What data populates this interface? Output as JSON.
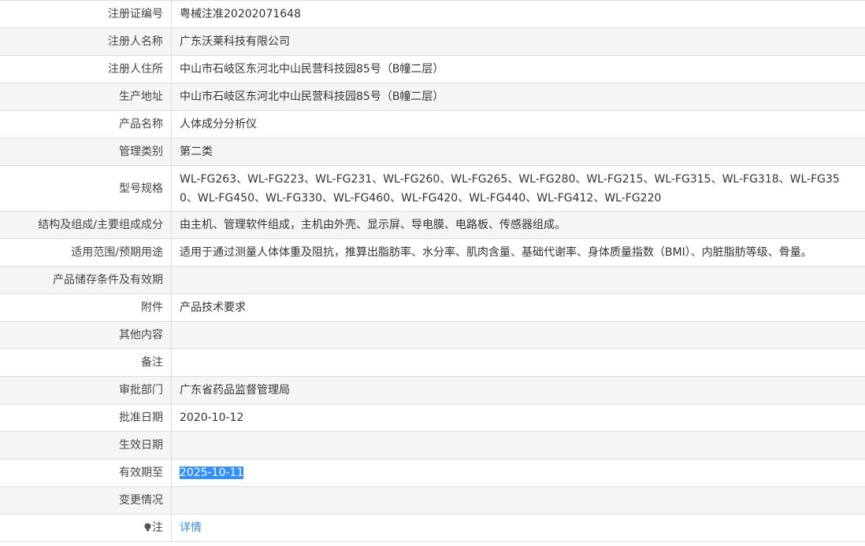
{
  "rows": [
    {
      "label": "注册证编号",
      "value": "粤械注准20202071648"
    },
    {
      "label": "注册人名称",
      "value": "广东沃莱科技有限公司"
    },
    {
      "label": "注册人住所",
      "value": "中山市石岐区东河北中山民营科技园85号（B幢二层）"
    },
    {
      "label": "生产地址",
      "value": "中山市石岐区东河北中山民营科技园85号（B幢二层）"
    },
    {
      "label": "产品名称",
      "value": "人体成分分析仪"
    },
    {
      "label": "管理类别",
      "value": "第二类"
    },
    {
      "label": "型号规格",
      "value": "WL-FG263、WL-FG223、WL-FG231、WL-FG260、WL-FG265、WL-FG280、WL-FG215、WL-FG315、WL-FG318、WL-FG350、WL-FG450、WL-FG330、WL-FG460、WL-FG420、WL-FG440、WL-FG412、WL-FG220"
    },
    {
      "label": "结构及组成/主要组成成分",
      "value": "由主机、管理软件组成，主机由外壳、显示屏、导电膜、电路板、传感器组成。"
    },
    {
      "label": "适用范围/预期用途",
      "value": "适用于通过测量人体体重及阻抗，推算出脂肪率、水分率、肌肉含量、基础代谢率、身体质量指数（BMI）、内脏脂肪等级、骨量。"
    },
    {
      "label": "产品储存条件及有效期",
      "value": ""
    },
    {
      "label": "附件",
      "value": "产品技术要求"
    },
    {
      "label": "其他内容",
      "value": ""
    },
    {
      "label": "备注",
      "value": ""
    },
    {
      "label": "审批部门",
      "value": "广东省药品监督管理局"
    },
    {
      "label": "批准日期",
      "value": "2020-10-12"
    },
    {
      "label": "生效日期",
      "value": ""
    },
    {
      "label": "有效期至",
      "value": "2025-10-11"
    },
    {
      "label": "变更情况",
      "value": ""
    },
    {
      "label": "注",
      "value": "详情"
    }
  ]
}
